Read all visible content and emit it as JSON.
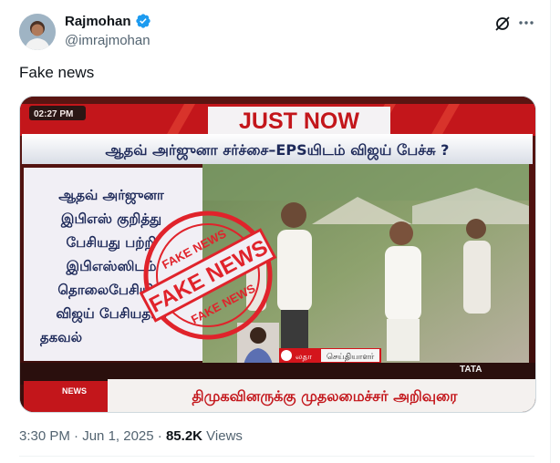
{
  "user": {
    "name": "Rajmohan",
    "handle": "@imrajmohan"
  },
  "tweet": {
    "text": "Fake news",
    "time": "3:30 PM",
    "separator": " · ",
    "date": "Jun 1, 2025",
    "views_count": "85.2K",
    "views_label": " Views"
  },
  "media": {
    "timestamp": "02:27 PM",
    "banner": "JUST NOW",
    "headline": "ஆதவ் அர்ஜுனா சர்ச்சை–EPSயிடம் விஜய் பேச்சு ?",
    "left_lines": [
      "ஆதவ் அர்ஜுனா",
      "இபிஎஸ் குறித்து",
      "பேசியது பற்றி",
      "இபிஎஸ்ஸிடம்",
      "தொலைபேசியில்",
      "விஜய் பேசியதாக",
      "தகவல்"
    ],
    "stamp_top": "FAKE NEWS",
    "stamp_middle": "FAKE NEWS",
    "stamp_bottom": "FAKE NEWS",
    "reporter_name": "லதா",
    "reporter_role": "செய்தியாளர்",
    "ticker": "திமுகவினருக்கு முதலமைச்சர் அறிவுரை",
    "channel_logo": "NEWS",
    "corner_logo": "TATA"
  },
  "colors": {
    "verified": "#1d9bf0",
    "banner_red": "#d4151c",
    "stamp_red": "#e0232b"
  }
}
